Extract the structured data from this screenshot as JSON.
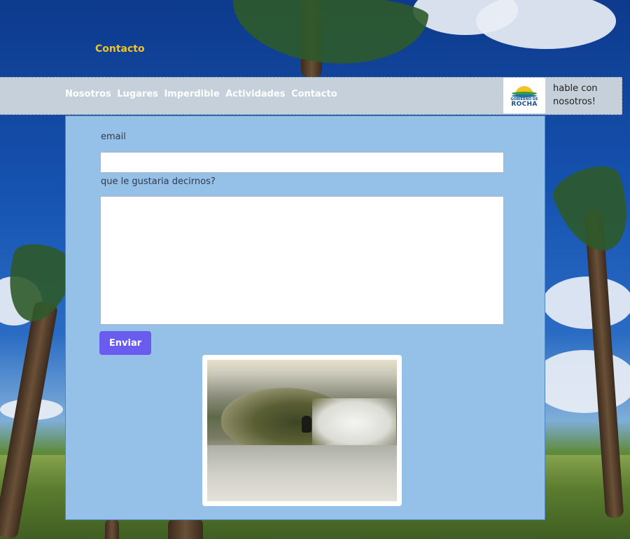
{
  "top_link": "Contacto",
  "nav": {
    "items": [
      {
        "label": "Nosotros"
      },
      {
        "label": "Lugares"
      },
      {
        "label": "Imperdible"
      },
      {
        "label": "Actividades"
      },
      {
        "label": "Contacto"
      }
    ],
    "logo": {
      "top_text": "GOBIERNO DE",
      "bottom_text": "ROCHA"
    },
    "talk_line1": "hable con",
    "talk_line2": "nosotros!"
  },
  "form": {
    "email_label": "email",
    "message_label": "que le gustaria decirnos?",
    "email_value": "",
    "message_value": "",
    "submit_label": "Enviar"
  },
  "colors": {
    "accent_link": "#f2c324",
    "button": "#6b5cf0",
    "panel": "#95c1e9",
    "navbar": "#c6d0da"
  }
}
